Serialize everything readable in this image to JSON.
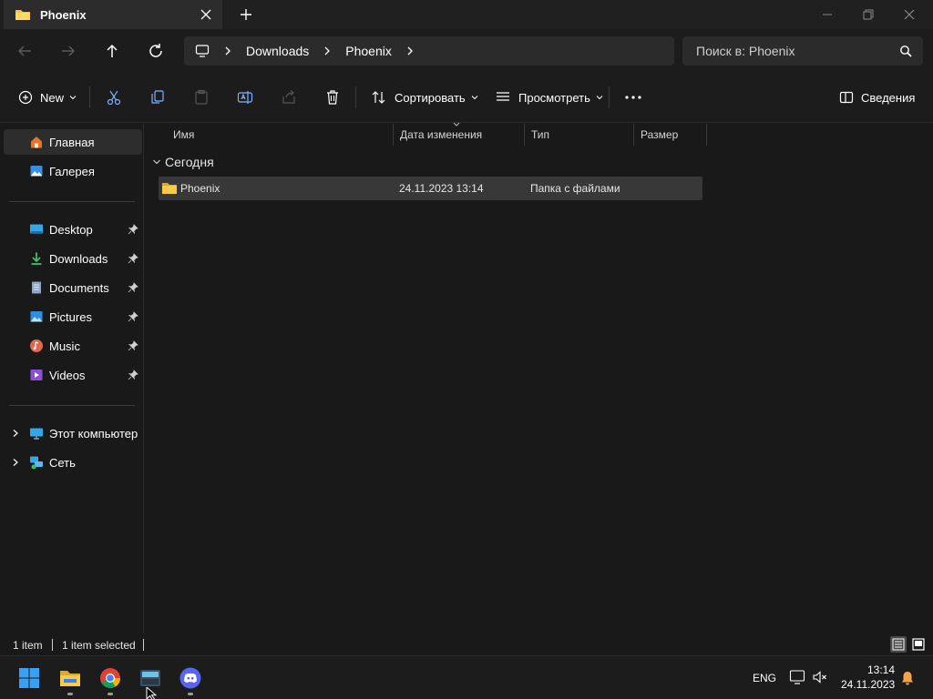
{
  "window": {
    "tab_title": "Phoenix",
    "colors": {
      "folder": "#f4c542",
      "accent": "#3b82f6"
    }
  },
  "address": {
    "crumbs": [
      "Downloads",
      "Phoenix"
    ],
    "search_placeholder": "Поиск в: Phoenix"
  },
  "commandbar": {
    "new_label": "New",
    "sort_label": "Сортировать",
    "view_label": "Просмотреть",
    "details_label": "Сведения"
  },
  "sidebar": {
    "items": [
      {
        "label": "Главная",
        "icon": "home-icon"
      },
      {
        "label": "Галерея",
        "icon": "gallery-icon"
      },
      {
        "label": "Desktop",
        "icon": "desktop-icon"
      },
      {
        "label": "Downloads",
        "icon": "downloads-icon"
      },
      {
        "label": "Documents",
        "icon": "documents-icon"
      },
      {
        "label": "Pictures",
        "icon": "pictures-icon"
      },
      {
        "label": "Music",
        "icon": "music-icon"
      },
      {
        "label": "Videos",
        "icon": "videos-icon"
      },
      {
        "label": "Этот компьютер",
        "icon": "computer-icon"
      },
      {
        "label": "Сеть",
        "icon": "network-icon"
      }
    ]
  },
  "content": {
    "columns": [
      "Имя",
      "Дата изменения",
      "Тип",
      "Размер"
    ],
    "group_label": "Сегодня",
    "rows": [
      {
        "name": "Phoenix",
        "date": "24.11.2023 13:14",
        "type": "Папка с файлами",
        "size": ""
      }
    ]
  },
  "status": {
    "count": "1 item",
    "selected": "1 item selected"
  },
  "taskbar": {
    "lang": "ENG",
    "time": "13:14",
    "date": "24.11.2023"
  }
}
